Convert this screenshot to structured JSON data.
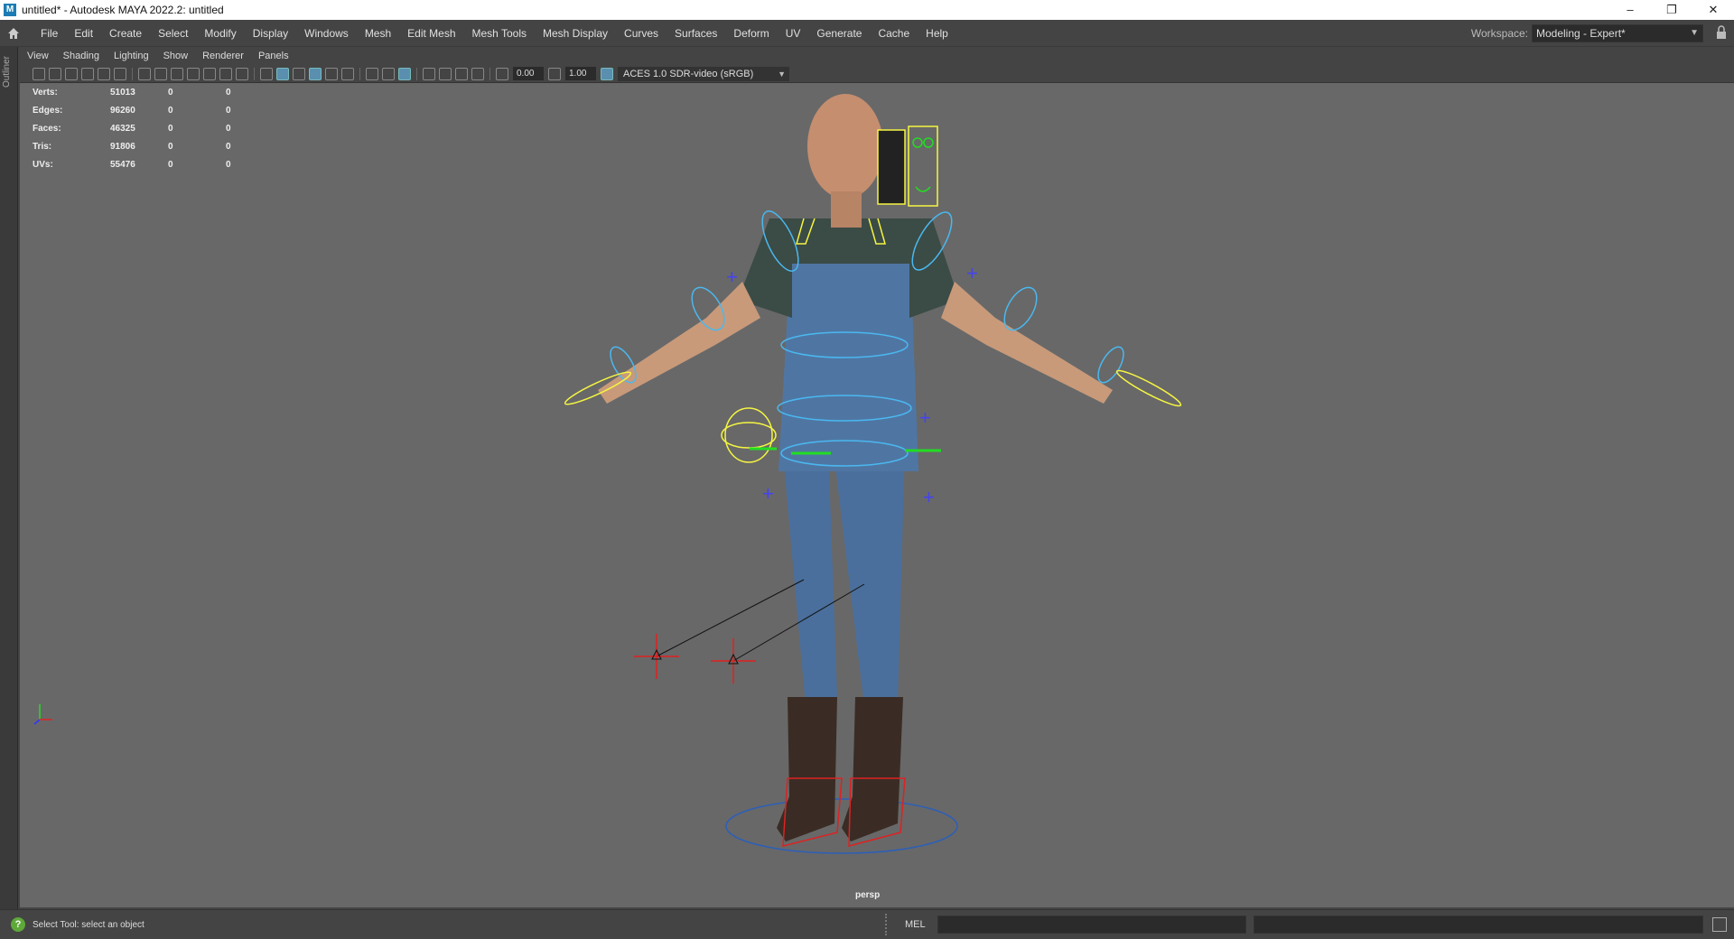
{
  "window": {
    "title": "untitled* - Autodesk MAYA 2022.2: untitled",
    "app_icon": "M",
    "controls": [
      "–",
      "❐",
      "✕"
    ]
  },
  "menubar": {
    "items": [
      "File",
      "Edit",
      "Create",
      "Select",
      "Modify",
      "Display",
      "Windows",
      "Mesh",
      "Edit Mesh",
      "Mesh Tools",
      "Mesh Display",
      "Curves",
      "Surfaces",
      "Deform",
      "UV",
      "Generate",
      "Cache",
      "Help"
    ],
    "workspace_label": "Workspace:",
    "workspace_value": "Modeling - Expert*"
  },
  "outliner": {
    "label": "Outliner"
  },
  "panel_menu": [
    "View",
    "Shading",
    "Lighting",
    "Show",
    "Renderer",
    "Panels"
  ],
  "toolbar": {
    "exposure": "0.00",
    "gamma": "1.00",
    "color_space": "ACES 1.0 SDR-video (sRGB)"
  },
  "hud": {
    "rows": [
      {
        "label": "Verts:",
        "v1": "51013",
        "v2": "0",
        "v3": "0"
      },
      {
        "label": "Edges:",
        "v1": "96260",
        "v2": "0",
        "v3": "0"
      },
      {
        "label": "Faces:",
        "v1": "46325",
        "v2": "0",
        "v3": "0"
      },
      {
        "label": "Tris:",
        "v1": "91806",
        "v2": "0",
        "v3": "0"
      },
      {
        "label": "UVs:",
        "v1": "55476",
        "v2": "0",
        "v3": "0"
      }
    ]
  },
  "viewport": {
    "camera": "persp"
  },
  "statusbar": {
    "help_text": "Select Tool: select an object",
    "mel_label": "MEL"
  },
  "colors": {
    "ui_bg": "#444444",
    "viewport_bg": "#686868",
    "control_blue": "#4ab8f0",
    "control_yellow": "#f5f542",
    "control_red": "#e02020",
    "control_green": "#22dd22"
  }
}
